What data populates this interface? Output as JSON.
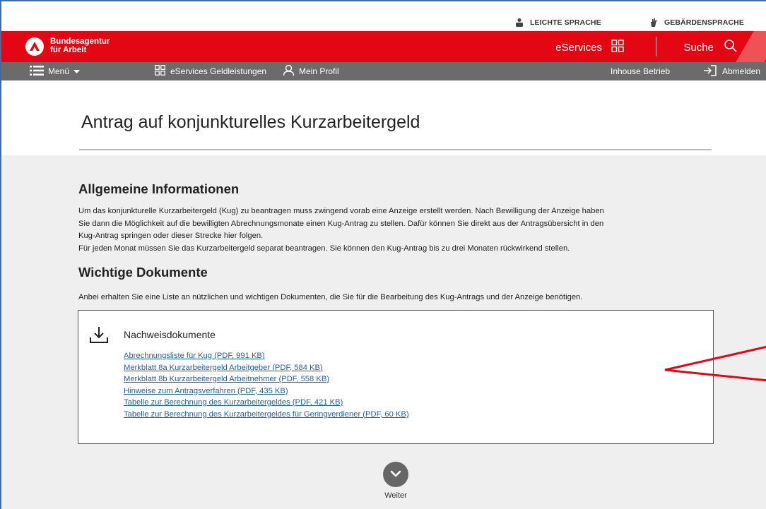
{
  "utility": {
    "easy_language": "LEICHTE SPRACHE",
    "sign_language": "GEBÄRDENSPRACHE"
  },
  "header": {
    "brand_line1": "Bundesagentur",
    "brand_line2": "für Arbeit",
    "eservices_label": "eServices",
    "search_label": "Suche"
  },
  "nav": {
    "menu_label": "Menü",
    "geldleistungen_label": "eServices Geldleistungen",
    "profile_label": "Mein Profil",
    "inhouse_label": "Inhouse Betrieb",
    "logout_label": "Abmelden"
  },
  "page": {
    "title": "Antrag auf konjunkturelles Kurzarbeitergeld"
  },
  "general_info": {
    "heading": "Allgemeine Informationen",
    "line1": "Um das konjunkturelle Kurzarbeitergeld (Kug) zu beantragen muss zwingend vorab eine Anzeige erstellt werden. Nach Bewilligung der Anzeige haben",
    "line2": "Sie dann die Möglichkeit auf die bewilligten Abrechnungsmonate einen Kug-Antrag zu stellen. Dafür können Sie direkt aus der Antragsübersicht in den",
    "line3": "Kug-Antrag springen oder dieser Strecke hier folgen.",
    "line4": "Für jeden Monat müssen Sie das Kurzarbeitergeld separat beantragen. Sie können den Kug-Antrag bis zu drei Monaten rückwirkend stellen."
  },
  "documents": {
    "heading": "Wichtige Dokumente",
    "intro": "Anbei erhalten Sie eine Liste an nützlichen und wichtigen Dokumenten, die Sie für die Bearbeitung des Kug-Antrags und der Anzeige benötigen.",
    "box_title": "Nachweisdokumente",
    "links": [
      "Abrechnungsliste für Kug (PDF, 991 KB)",
      "Merkblatt 8a Kurzarbeitergeld Arbeitgeber (PDF, 584 KB)",
      "Merkblatt 8b Kurzarbeitergeld Arbeitnehmer (PDF, 558 KB)",
      "Hinweise zum Antragsverfahren (PDF, 435 KB)",
      "Tabelle zur Berechnung des Kurzarbeitergeldes (PDF, 421 KB)",
      "Tabelle zur Berechnung des Kurzarbeitergeldes für Geringverdiener (PDF, 60 KB)"
    ]
  },
  "footer": {
    "next_label": "Weiter"
  },
  "colors": {
    "brand_red": "#e30613",
    "nav_grey": "#6b6b6b",
    "content_bg": "#efefef",
    "link_blue": "#1f5fa8",
    "annotation_red": "#e30613"
  },
  "icons": [
    "easy-language-icon",
    "sign-language-icon",
    "ba-logo-icon",
    "grid-icon",
    "search-icon",
    "hamburger-icon",
    "chevron-down-icon",
    "user-icon",
    "logout-icon",
    "download-icon",
    "weiter-chevron-icon"
  ]
}
